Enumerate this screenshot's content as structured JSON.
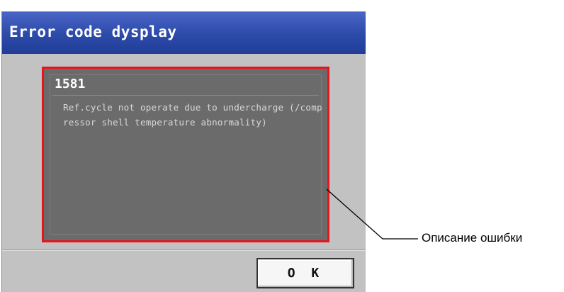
{
  "dialog": {
    "title": "Error code dysplay",
    "error_code": "1581",
    "error_description": "Ref.cycle not operate due to undercharge (/compressor shell temperature abnormality)",
    "ok_label": "O K"
  },
  "annotation": {
    "label": "Описание ошибки"
  },
  "colors": {
    "titlebar": "#2c4aa8",
    "panel": "#6b6b6b",
    "highlight_border": "#e8141c",
    "dialog_background": "#c2c2c2"
  }
}
